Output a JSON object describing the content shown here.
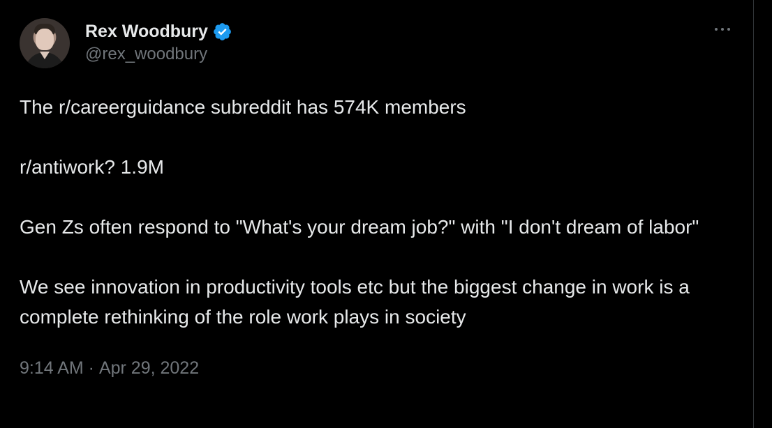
{
  "tweet": {
    "author": {
      "display_name": "Rex Woodbury",
      "handle": "@rex_woodbury",
      "verified": true
    },
    "body": {
      "paragraphs": [
        "The r/careerguidance subreddit has 574K members",
        "r/antiwork? 1.9M",
        "Gen Zs often respond to \"What's your dream job?\" with \"I don't dream of labor\"",
        "We see innovation in productivity tools etc but the biggest change in work is a complete rethinking of the role work plays in society"
      ]
    },
    "meta": {
      "time": "9:14 AM",
      "separator": " · ",
      "date": "Apr 29, 2022"
    }
  },
  "colors": {
    "background": "#000000",
    "text_primary": "#e7e9ea",
    "text_secondary": "#71767b",
    "verified_blue": "#1d9bf0",
    "border": "#2f3336"
  },
  "icons": {
    "verified": "verified-badge-icon",
    "more": "more-options-icon"
  }
}
